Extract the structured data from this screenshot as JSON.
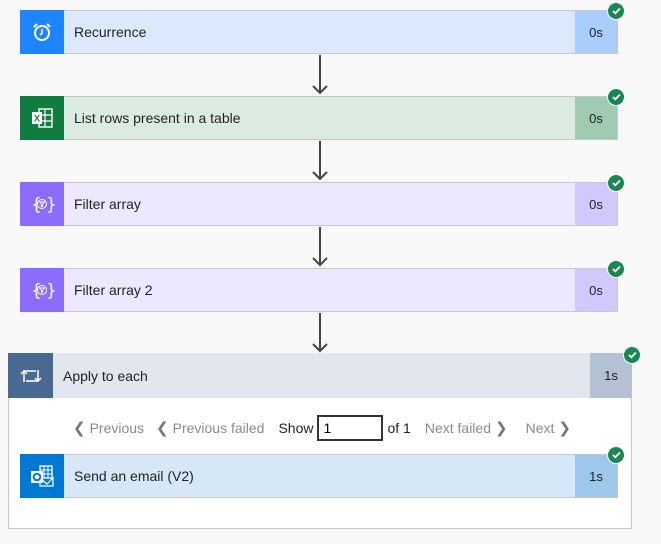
{
  "flow": {
    "steps": [
      {
        "title": "Recurrence",
        "duration": "0s",
        "icon": "alarm-clock-icon",
        "status": "succeeded"
      },
      {
        "title": "List rows present in a table",
        "duration": "0s",
        "icon": "excel-icon",
        "status": "succeeded"
      },
      {
        "title": "Filter array",
        "duration": "0s",
        "icon": "filter-array-icon",
        "status": "succeeded"
      },
      {
        "title": "Filter array 2",
        "duration": "0s",
        "icon": "filter-array-icon",
        "status": "succeeded"
      }
    ],
    "loop": {
      "title": "Apply to each",
      "duration": "1s",
      "icon": "loop-icon",
      "status": "succeeded",
      "pager": {
        "previous": "Previous",
        "previous_failed": "Previous failed",
        "show": "Show",
        "current": "1",
        "of": "of 1",
        "next_failed": "Next failed",
        "next": "Next"
      },
      "inner_step": {
        "title": "Send an email (V2)",
        "duration": "1s",
        "icon": "outlook-icon",
        "status": "succeeded"
      }
    }
  },
  "colors": {
    "success": "#198754",
    "recurrence": "#1f85ff",
    "excel": "#107c41",
    "filter": "#8c6cff",
    "loop": "#486991",
    "outlook": "#0078d4"
  }
}
